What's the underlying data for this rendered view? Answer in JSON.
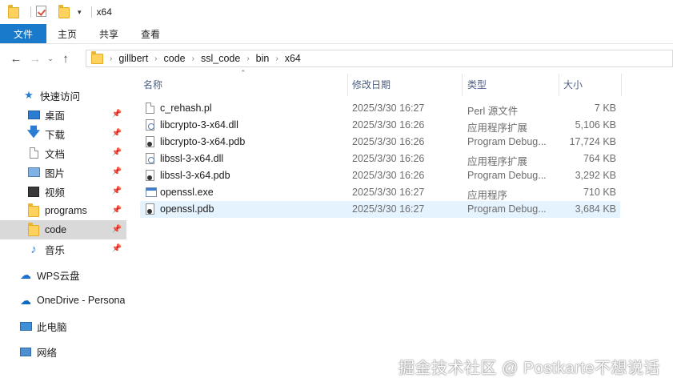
{
  "window": {
    "title": "x64"
  },
  "ribbon": {
    "tabs": [
      {
        "label": "文件"
      },
      {
        "label": "主页"
      },
      {
        "label": "共享"
      },
      {
        "label": "查看"
      }
    ]
  },
  "address": {
    "path": [
      "gillbert",
      "code",
      "ssl_code",
      "bin",
      "x64"
    ]
  },
  "nav": {
    "quick_access": "快速访问",
    "items": [
      {
        "label": "桌面",
        "icon": "desktop-icon",
        "pinned": true
      },
      {
        "label": "下载",
        "icon": "download-icon",
        "pinned": true
      },
      {
        "label": "文档",
        "icon": "documents-icon",
        "pinned": true
      },
      {
        "label": "图片",
        "icon": "pictures-icon",
        "pinned": true
      },
      {
        "label": "视频",
        "icon": "videos-icon",
        "pinned": true
      },
      {
        "label": "programs",
        "icon": "folder-icon",
        "pinned": true
      },
      {
        "label": "code",
        "icon": "folder-icon",
        "pinned": true,
        "selected": true
      },
      {
        "label": "音乐",
        "icon": "music-icon",
        "pinned": true
      }
    ],
    "wps": "WPS云盘",
    "onedrive": "OneDrive - Persona",
    "this_pc": "此电脑",
    "network": "网络"
  },
  "columns": {
    "name": "名称",
    "date": "修改日期",
    "type": "类型",
    "size": "大小"
  },
  "files": [
    {
      "name": "c_rehash.pl",
      "date": "2025/3/30 16:27",
      "type": "Perl 源文件",
      "size": "7 KB",
      "icon": "perl-file-icon"
    },
    {
      "name": "libcrypto-3-x64.dll",
      "date": "2025/3/30 16:26",
      "type": "应用程序扩展",
      "size": "5,106 KB",
      "icon": "dll-file-icon"
    },
    {
      "name": "libcrypto-3-x64.pdb",
      "date": "2025/3/30 16:26",
      "type": "Program Debug...",
      "size": "17,724 KB",
      "icon": "pdb-file-icon"
    },
    {
      "name": "libssl-3-x64.dll",
      "date": "2025/3/30 16:26",
      "type": "应用程序扩展",
      "size": "764 KB",
      "icon": "dll-file-icon"
    },
    {
      "name": "libssl-3-x64.pdb",
      "date": "2025/3/30 16:26",
      "type": "Program Debug...",
      "size": "3,292 KB",
      "icon": "pdb-file-icon"
    },
    {
      "name": "openssl.exe",
      "date": "2025/3/30 16:27",
      "type": "应用程序",
      "size": "710 KB",
      "icon": "exe-file-icon"
    },
    {
      "name": "openssl.pdb",
      "date": "2025/3/30 16:27",
      "type": "Program Debug...",
      "size": "3,684 KB",
      "icon": "pdb-file-icon",
      "selected": true
    }
  ],
  "watermark": "掘金技术社区 @ Postkarte不想说话",
  "colors": {
    "accent": "#1979ca",
    "selection": "#e5f3ff",
    "nav_selected": "#d9d9d9",
    "folder": "#ffd25e"
  }
}
